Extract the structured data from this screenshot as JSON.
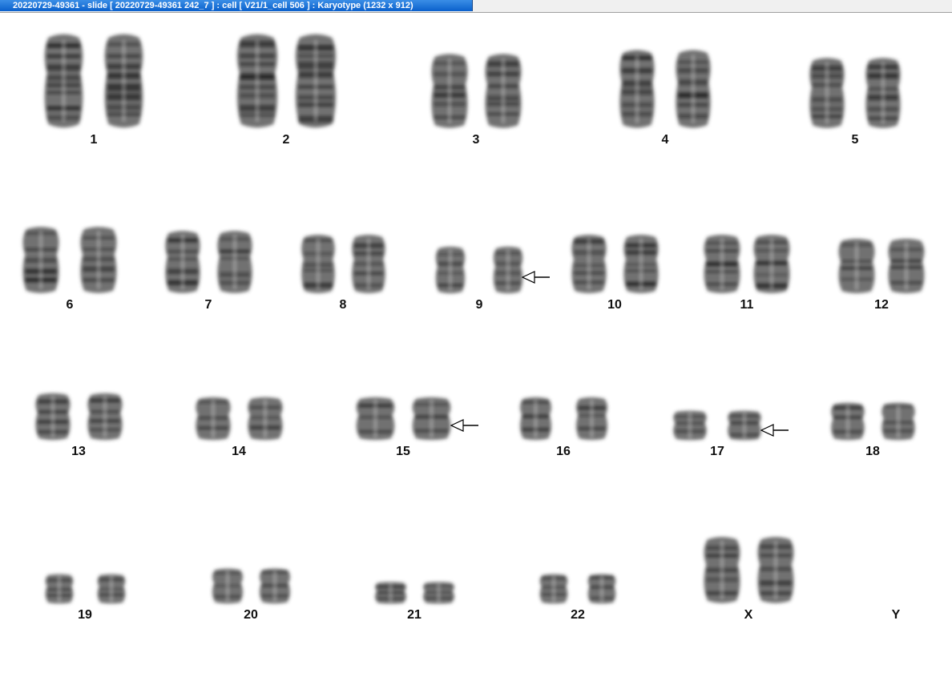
{
  "window": {
    "title": "20220729-49361 - slide [ 20220729-49361 242_7 ] : cell [ V21/1_cell 506 ] : Karyotype  (1232 x 912)"
  },
  "karyotype": {
    "chromosomes": [
      {
        "label": "1",
        "pair": 2,
        "abnormal": false
      },
      {
        "label": "2",
        "pair": 2,
        "abnormal": false
      },
      {
        "label": "3",
        "pair": 2,
        "abnormal": false
      },
      {
        "label": "4",
        "pair": 2,
        "abnormal": false
      },
      {
        "label": "5",
        "pair": 2,
        "abnormal": false
      },
      {
        "label": "6",
        "pair": 2,
        "abnormal": false
      },
      {
        "label": "7",
        "pair": 2,
        "abnormal": false
      },
      {
        "label": "8",
        "pair": 2,
        "abnormal": false
      },
      {
        "label": "9",
        "pair": 2,
        "abnormal": true
      },
      {
        "label": "10",
        "pair": 2,
        "abnormal": false
      },
      {
        "label": "11",
        "pair": 2,
        "abnormal": false
      },
      {
        "label": "12",
        "pair": 2,
        "abnormal": false
      },
      {
        "label": "13",
        "pair": 2,
        "abnormal": false
      },
      {
        "label": "14",
        "pair": 2,
        "abnormal": false
      },
      {
        "label": "15",
        "pair": 2,
        "abnormal": true
      },
      {
        "label": "16",
        "pair": 2,
        "abnormal": false
      },
      {
        "label": "17",
        "pair": 2,
        "abnormal": true
      },
      {
        "label": "18",
        "pair": 2,
        "abnormal": false
      },
      {
        "label": "19",
        "pair": 2,
        "abnormal": false
      },
      {
        "label": "20",
        "pair": 2,
        "abnormal": false
      },
      {
        "label": "21",
        "pair": 2,
        "abnormal": false
      },
      {
        "label": "22",
        "pair": 2,
        "abnormal": false
      },
      {
        "label": "X",
        "pair": 2,
        "abnormal": false
      },
      {
        "label": "Y",
        "pair": 0,
        "abnormal": false
      }
    ]
  },
  "colors": {
    "title_bar": "#0a60cc",
    "title_text": "#ffffff",
    "chromosome": "#3a3a3a",
    "band_dark": "#1a1a1a",
    "arrow": "#000000"
  }
}
